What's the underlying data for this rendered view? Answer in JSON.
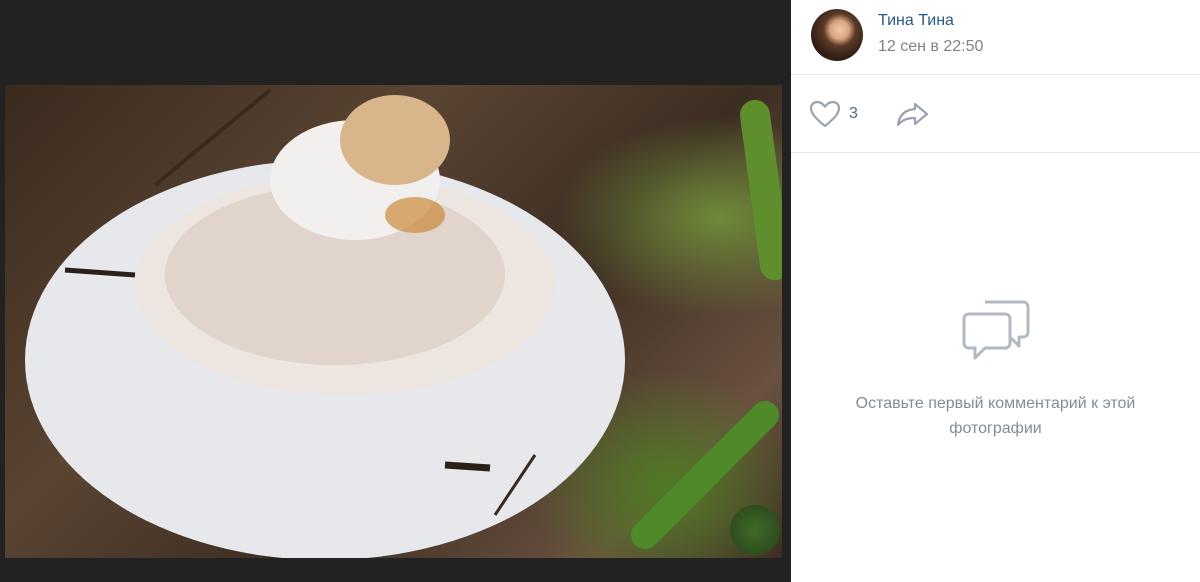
{
  "photo": {
    "description_icon": "mushroom-photo"
  },
  "author": {
    "name": "Тина Тина",
    "date": "12 сен в 22:50"
  },
  "actions": {
    "like_count": "3",
    "like_icon": "heart-icon",
    "share_icon": "share-arrow-icon"
  },
  "comments": {
    "empty_icon": "speech-bubbles-icon",
    "empty_text": "Оставьте первый комментарий к этой фотографии"
  },
  "colors": {
    "viewer_bg": "#222222",
    "link": "#2a5885",
    "muted": "#828282",
    "icon": "#99a2ad"
  }
}
